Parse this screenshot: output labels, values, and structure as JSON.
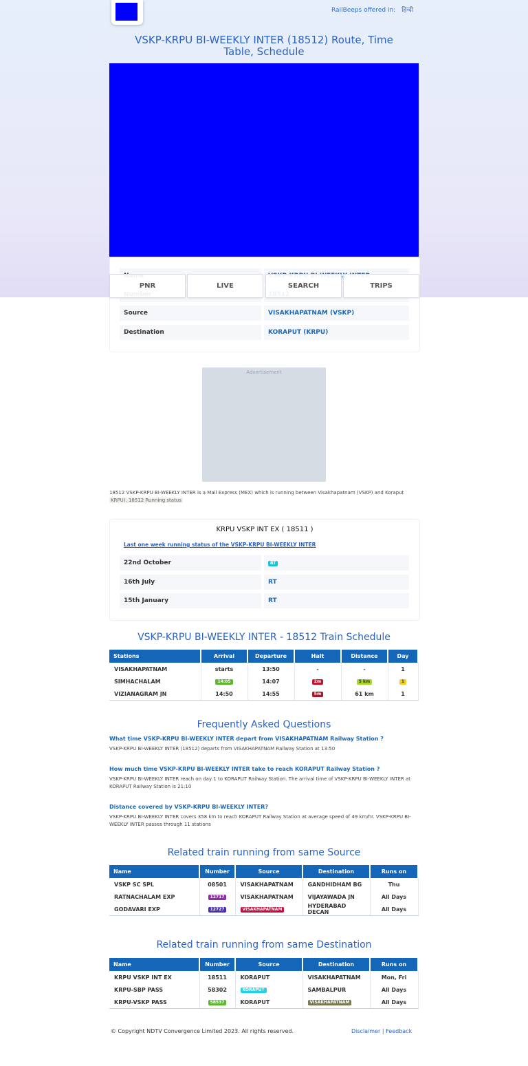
{
  "header": {
    "offered_text": "RailBeeps offered in:",
    "language": "हिन्दी",
    "logo_icon": "railbeeps-logo-icon"
  },
  "page_title": "VSKP-KRPU BI-WEEKLY INTER (18512) Route, Time Table, Schedule",
  "tabs": [
    "PNR",
    "LIVE",
    "SEARCH",
    "TRIPS"
  ],
  "train_info": [
    {
      "key": "Name",
      "value": "VSKP-KRPU BI-WEEKLY INTER"
    },
    {
      "key": "Number",
      "value": "18512"
    },
    {
      "key": "Source",
      "value": "VISAKHAPATNAM (VSKP)"
    },
    {
      "key": "Destination",
      "value": "KORAPUT (KRPU)"
    }
  ],
  "ad_label": "Advertisement",
  "description": "18512 VSKP-KRPU BI-WEEKLY INTER is a Mail Express (MEX) which is running between Visakhapatnam (VSKP) and Koraput",
  "description_tail": "KRPU). 18512 Running status",
  "running_status": {
    "heading": "KRPU VSKP INT EX ( 18511 )",
    "subheading": "Last one week running status of the VSKP-KRPU BI-WEEKLY INTER",
    "rows": [
      {
        "date": "22nd October",
        "status": "RT",
        "pill": true
      },
      {
        "date": "16th July",
        "status": "RT",
        "pill": false
      },
      {
        "date": "15th January",
        "status": "RT",
        "pill": false
      }
    ]
  },
  "schedule": {
    "title": "VSKP-KRPU BI-WEEKLY INTER - 18512 Train Schedule",
    "headers": [
      "Stations",
      "Arrival",
      "Departure",
      "Halt",
      "Distance",
      "Day"
    ],
    "rows": [
      {
        "station": "VISAKHAPATNAM",
        "arrival": "starts",
        "departure": "13:50",
        "halt": "-",
        "distance": "-",
        "day": "1"
      },
      {
        "station": "SIMHACHALAM",
        "arrival": "14:05",
        "departure": "14:07",
        "halt": "2m",
        "distance": "5 km",
        "day": "1"
      },
      {
        "station": "VIZIANAGRAM JN",
        "arrival": "14:50",
        "departure": "14:55",
        "halt": "5m",
        "distance": "61 km",
        "day": "1"
      }
    ]
  },
  "faq": {
    "title": "Frequently Asked Questions",
    "items": [
      {
        "q": "What time VSKP-KRPU BI-WEEKLY INTER depart from VISAKHAPATNAM Railway Station ?",
        "a": "VSKP-KRPU BI-WEEKLY INTER (18512) departs from VISAKHAPATNAM Railway Station at 13:50"
      },
      {
        "q": "How much time VSKP-KRPU BI-WEEKLY INTER take to reach KORAPUT Railway Station ?",
        "a": "VSKP-KRPU BI-WEEKLY INTER reach on day 1 to KORAPUT Railway Station. The arrival time of VSKP-KRPU BI-WEEKLY INTER at KORAPUT Railway Station is 21:10"
      },
      {
        "q": "Distance covered by VSKP-KRPU BI-WEEKLY INTER?",
        "a": "VSKP-KRPU BI-WEEKLY INTER covers 358 km to reach KORAPUT Railway Station at average speed of 49 km/hr. VSKP-KRPU BI-WEEKLY INTER passes through 11 stations"
      }
    ]
  },
  "same_source": {
    "title": "Related train running from same Source",
    "headers": [
      "Name",
      "Number",
      "Source",
      "Destination",
      "Runs on"
    ],
    "rows": [
      {
        "name": "VSKP SC SPL",
        "number": "08501",
        "source": "VISAKHAPATNAM",
        "destination": "GANDHIDHAM BG",
        "runs": "Thu"
      },
      {
        "name": "RATNACHALAM EXP",
        "number": "12717",
        "source": "VISAKHAPATNAM",
        "destination": "VIJAYAWADA JN",
        "runs": "All Days"
      },
      {
        "name": "GODAVARI EXP",
        "number": "12727",
        "source": "VISAKHAPATNAM",
        "destination": "HYDERABAD DECAN",
        "runs": "All Days"
      }
    ]
  },
  "same_destination": {
    "title": "Related train running from same Destination",
    "headers": [
      "Name",
      "Number",
      "Source",
      "Destination",
      "Runs on"
    ],
    "rows": [
      {
        "name": "KRPU VSKP INT EX",
        "number": "18511",
        "source": "KORAPUT",
        "destination": "VISAKHAPATNAM",
        "runs": "Mon, Fri"
      },
      {
        "name": "KRPU-SBP PASS",
        "number": "58302",
        "source": "KORAPUT",
        "destination": "SAMBALPUR",
        "runs": "All Days"
      },
      {
        "name": "KRPU-VSKP PASS",
        "number": "58537",
        "source": "KORAPUT",
        "destination": "VISAKHAPATNAM",
        "runs": "All Days"
      }
    ]
  },
  "footer": {
    "copyright": "© Copyright NDTV Convergence Limited 2023. All rights reserved.",
    "links": [
      "Disclaimer",
      "Feedback"
    ]
  },
  "colors": {
    "link": "#1a67b8",
    "table_header": "#1466b8",
    "hero": "#0000ff"
  }
}
